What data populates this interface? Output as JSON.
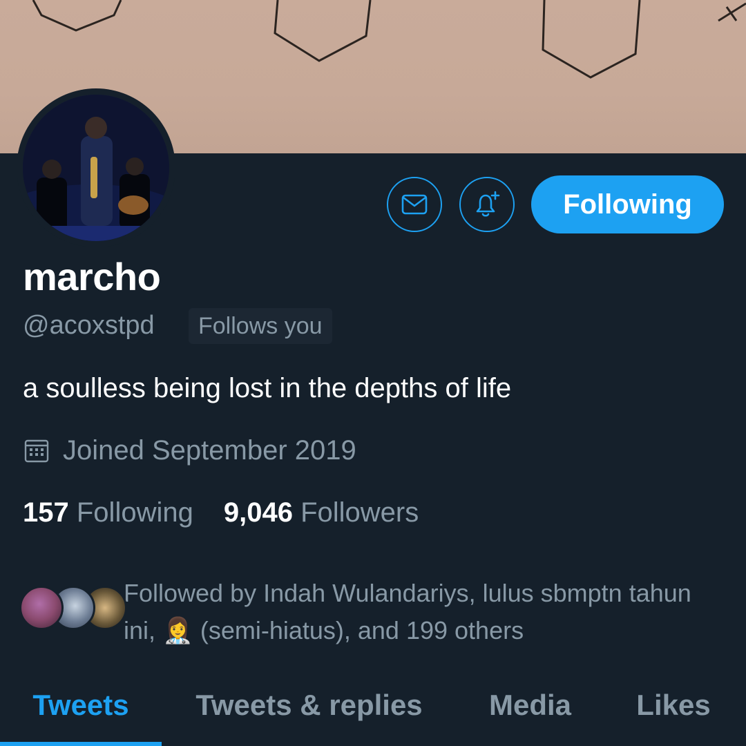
{
  "profile": {
    "display_name": "marcho",
    "handle": "@acoxstpd",
    "follows_you_badge": "Follows you",
    "bio": "a soulless being lost in the depths of life",
    "joined": "Joined September 2019",
    "following_count": "157",
    "following_label": "Following",
    "followers_count": "9,046",
    "followers_label": "Followers",
    "followed_by": "Followed by Indah Wulandariys, lulus sbmptn tahun ini, 👩‍⚕️ (semi-hiatus), and 199 others"
  },
  "actions": {
    "message_icon": "mail-icon",
    "notify_icon": "bell-plus-icon",
    "following_button": "Following"
  },
  "tabs": [
    {
      "label": "Tweets",
      "active": true
    },
    {
      "label": "Tweets & replies",
      "active": false
    },
    {
      "label": "Media",
      "active": false
    },
    {
      "label": "Likes",
      "active": false
    }
  ],
  "colors": {
    "background": "#15202b",
    "accent": "#1da1f2",
    "secondary_text": "#8899a6",
    "badge_bg": "#1c2733"
  }
}
